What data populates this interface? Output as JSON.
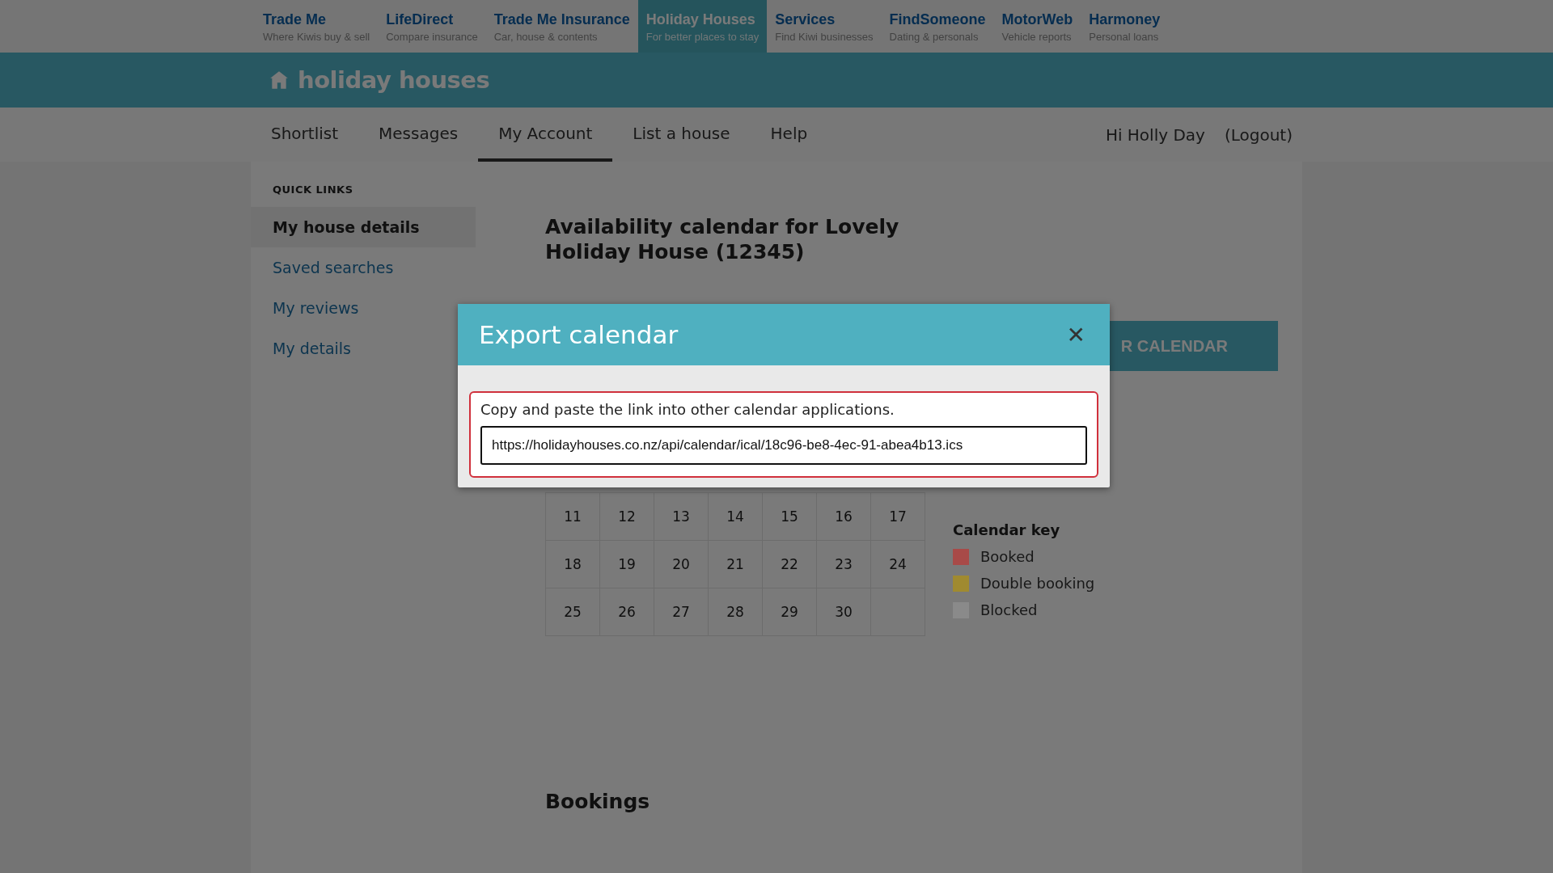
{
  "site_bar": [
    {
      "name": "Trade Me",
      "tagline": "Where Kiwis buy & sell",
      "selected": false
    },
    {
      "name": "LifeDirect",
      "tagline": "Compare insurance",
      "selected": false
    },
    {
      "name": "Trade Me Insurance",
      "tagline": "Car, house & contents",
      "selected": false
    },
    {
      "name": "Holiday Houses",
      "tagline": "For better places to stay",
      "selected": true
    },
    {
      "name": "Services",
      "tagline": "Find Kiwi businesses",
      "selected": false
    },
    {
      "name": "FindSomeone",
      "tagline": "Dating & personals",
      "selected": false
    },
    {
      "name": "MotorWeb",
      "tagline": "Vehicle reports",
      "selected": false
    },
    {
      "name": "Harmoney",
      "tagline": "Personal loans",
      "selected": false
    }
  ],
  "brand": {
    "name": "holiday houses"
  },
  "nav": {
    "items": [
      {
        "label": "Shortlist",
        "selected": false
      },
      {
        "label": "Messages",
        "selected": false
      },
      {
        "label": "My Account",
        "selected": true
      },
      {
        "label": "List a house",
        "selected": false
      },
      {
        "label": "Help",
        "selected": false
      }
    ],
    "greeting": "Hi Holly Day",
    "logout": "(Logout)"
  },
  "sidebar": {
    "heading": "QUICK LINKS",
    "items": [
      {
        "label": "My house details",
        "selected": true
      },
      {
        "label": "Saved searches",
        "selected": false
      },
      {
        "label": "My reviews",
        "selected": false
      },
      {
        "label": "My details",
        "selected": false
      }
    ]
  },
  "main": {
    "title": "Availability calendar for Lovely Holiday House (12345)",
    "action_button": "R CALENDAR",
    "calendar_rows": [
      [
        "11",
        "12",
        "13",
        "14",
        "15",
        "16",
        "17"
      ],
      [
        "18",
        "19",
        "20",
        "21",
        "22",
        "23",
        "24"
      ],
      [
        "25",
        "26",
        "27",
        "28",
        "29",
        "30"
      ]
    ],
    "key": {
      "title": "Calendar key",
      "items": [
        {
          "label": "Booked",
          "color": "#a84a48"
        },
        {
          "label": "Double booking",
          "color": "#a08a30"
        },
        {
          "label": "Blocked",
          "color": "#8a8a8a"
        }
      ]
    },
    "bookings_title": "Bookings"
  },
  "modal": {
    "title": "Export calendar",
    "close": "✕",
    "instruction": "Copy and paste the link into other calendar applications.",
    "link_value": "https://holidayhouses.co.nz/api/calendar/ical/18c96-be8-4ec-91-abea4b13.ics"
  }
}
